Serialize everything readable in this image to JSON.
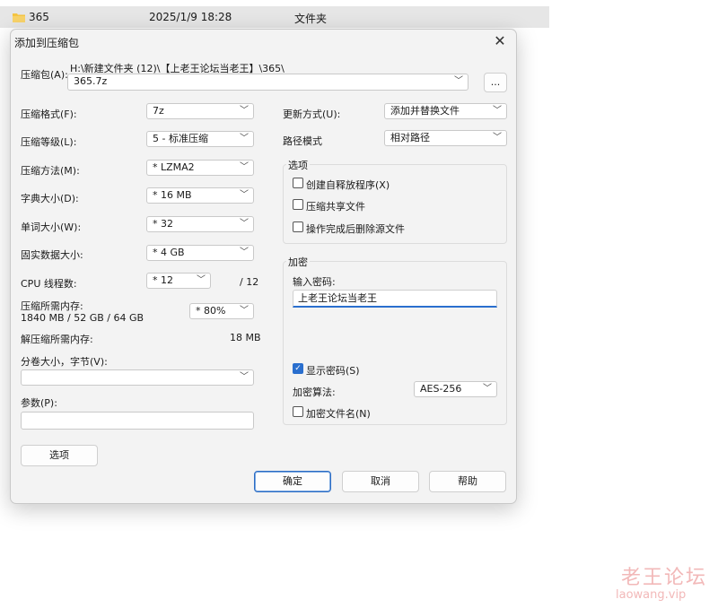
{
  "explorer": {
    "name": "365",
    "date": "2025/1/9 18:28",
    "type": "文件夹"
  },
  "dialog": {
    "title": "添加到压缩包",
    "archive_label": "压缩包(A):",
    "archive_path": "H:\\新建文件夹 (12)\\【上老王论坛当老王】\\365\\",
    "archive_name": "365.7z",
    "browse_label": "...",
    "left": {
      "format_label": "压缩格式(F):",
      "format_value": "7z",
      "level_label": "压缩等级(L):",
      "level_value": "5 - 标准压缩",
      "method_label": "压缩方法(M):",
      "method_value": "*  LZMA2",
      "dict_label": "字典大小(D):",
      "dict_value": "*  16 MB",
      "word_label": "单词大小(W):",
      "word_value": "*  32",
      "solid_label": "固实数据大小:",
      "solid_value": "*  4 GB",
      "threads_label": "CPU 线程数:",
      "threads_value": "*  12",
      "threads_total": "/ 12",
      "mem_comp_label": "压缩所需内存:",
      "mem_comp_detail": "1840 MB / 52 GB / 64 GB",
      "mem_comp_value": "*  80%",
      "mem_decomp_label": "解压缩所需内存:",
      "mem_decomp_value": "18 MB",
      "split_label": "分卷大小，字节(V):",
      "split_value": "",
      "params_label": "参数(P):",
      "params_value": "",
      "options_button": "选项"
    },
    "right": {
      "update_label": "更新方式(U):",
      "update_value": "添加并替换文件",
      "path_label": "路径模式",
      "path_value": "相对路径",
      "options_group": "选项",
      "opt_sfx": "创建自释放程序(X)",
      "opt_shared": "压缩共享文件",
      "opt_delete": "操作完成后删除源文件",
      "encrypt_group": "加密",
      "password_label": "输入密码:",
      "password_value": "上老王论坛当老王",
      "show_password": "显示密码(S)",
      "show_password_checked": true,
      "enc_method_label": "加密算法:",
      "enc_method_value": "AES-256",
      "encrypt_names": "加密文件名(N)"
    },
    "buttons": {
      "ok": "确定",
      "cancel": "取消",
      "help": "帮助"
    }
  },
  "watermark": {
    "cn": "老王论坛",
    "en": "laowang.vip"
  }
}
